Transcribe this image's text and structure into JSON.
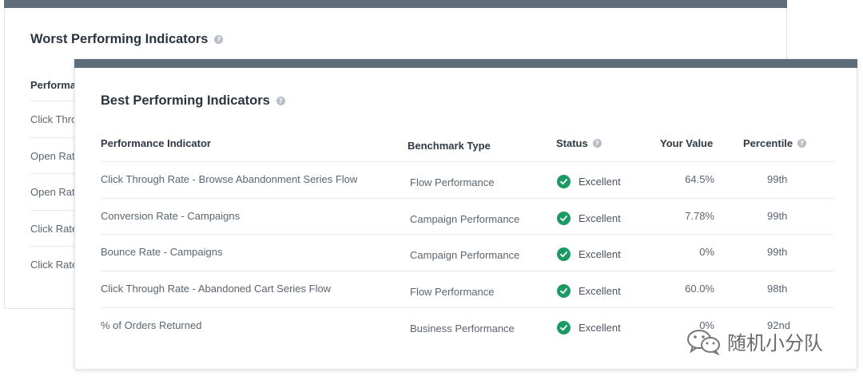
{
  "worst_card": {
    "title": "Worst Performing Indicators",
    "column_header": "Performa",
    "rows": [
      "Click Thro",
      "Open Rat",
      "Open Rat",
      "Click Rate",
      "Click Rate"
    ]
  },
  "best_card": {
    "title": "Best Performing Indicators",
    "columns": {
      "indicator": "Performance Indicator",
      "benchmark": "Benchmark Type",
      "status": "Status",
      "value": "Your Value",
      "percentile": "Percentile"
    },
    "rows": [
      {
        "indicator": "Click Through Rate - Browse Abandonment Series Flow",
        "benchmark": "Flow Performance",
        "status": "Excellent",
        "value": "64.5%",
        "percentile": "99th"
      },
      {
        "indicator": "Conversion Rate - Campaigns",
        "benchmark": "Campaign Performance",
        "status": "Excellent",
        "value": "7.78%",
        "percentile": "99th"
      },
      {
        "indicator": "Bounce Rate - Campaigns",
        "benchmark": "Campaign Performance",
        "status": "Excellent",
        "value": "0%",
        "percentile": "99th"
      },
      {
        "indicator": "Click Through Rate - Abandoned Cart Series Flow",
        "benchmark": "Flow Performance",
        "status": "Excellent",
        "value": "60.0%",
        "percentile": "98th"
      },
      {
        "indicator": "% of Orders Returned",
        "benchmark": "Business Performance",
        "status": "Excellent",
        "value": "0%",
        "percentile": "92nd"
      }
    ]
  },
  "watermark": {
    "text": "随机小分队"
  },
  "colors": {
    "header_bar": "#5f6c79",
    "excellent": "#1d9a63",
    "help": "#b7bec6"
  }
}
